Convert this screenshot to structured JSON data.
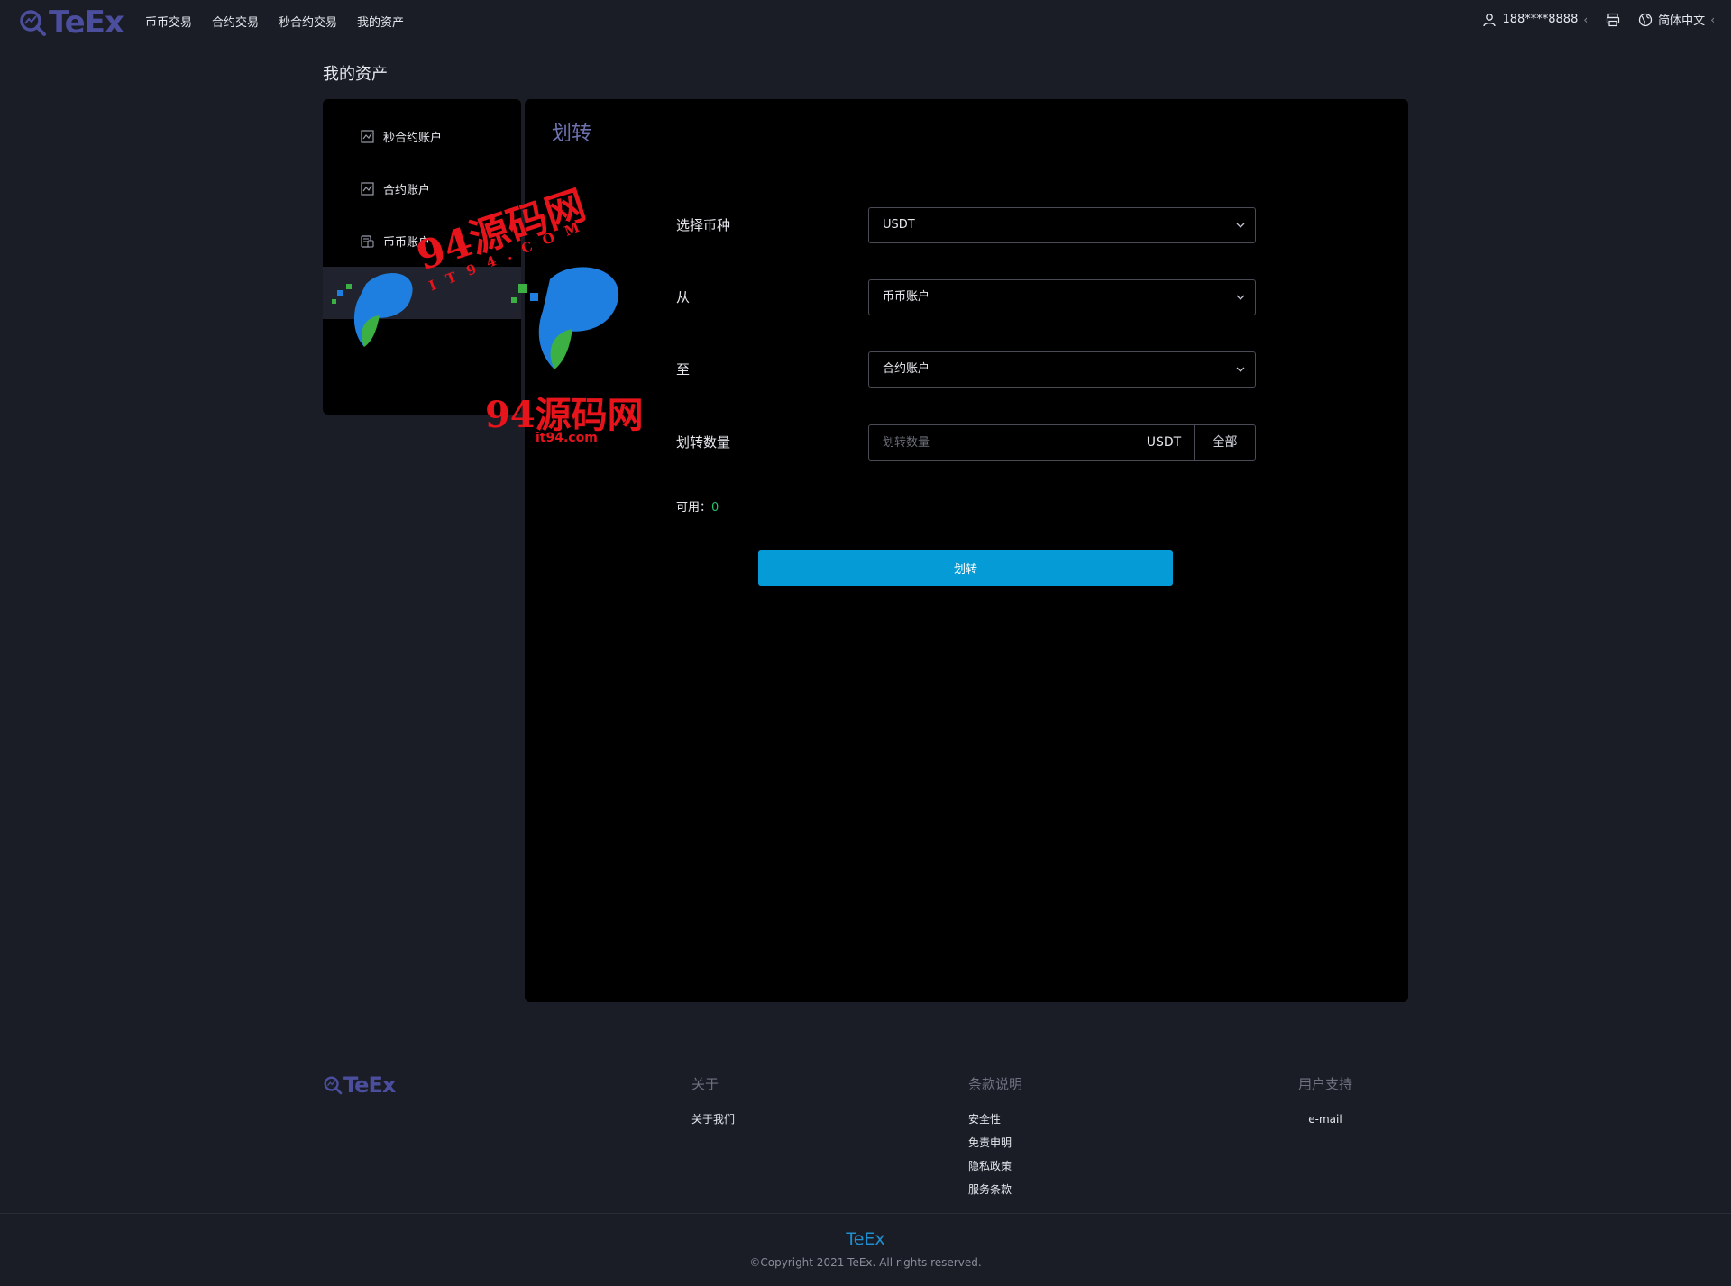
{
  "brand": {
    "logo_text": "TeEx"
  },
  "nav": {
    "items": [
      "币币交易",
      "合约交易",
      "秒合约交易",
      "我的资产"
    ]
  },
  "header_right": {
    "user": "188****8888",
    "language": "简体中文"
  },
  "page_title": "我的资产",
  "sidebar": {
    "items": [
      {
        "label": "秒合约账户",
        "icon": "chart-icon"
      },
      {
        "label": "合约账户",
        "icon": "chart-icon"
      },
      {
        "label": "币币账户",
        "icon": "wallet-icon"
      }
    ]
  },
  "transfer": {
    "title": "划转",
    "coin_label": "选择币种",
    "coin_value": "USDT",
    "from_label": "从",
    "from_value": "币币账户",
    "to_label": "至",
    "to_value": "合约账户",
    "amount_label": "划转数量",
    "amount_placeholder": "划转数量",
    "amount_unit": "USDT",
    "all_label": "全部",
    "available_label": "可用：",
    "available_value": "0",
    "submit_label": "划转"
  },
  "watermark": {
    "text_main": "94源码网",
    "text_spaced": "I T 9 4 . C O M",
    "text_bottom": "94源码网",
    "text_url": "it94.com"
  },
  "footer": {
    "about": {
      "title": "关于",
      "links": [
        "关于我们"
      ]
    },
    "terms": {
      "title": "条款说明",
      "links": [
        "安全性",
        "免责申明",
        "隐私政策",
        "服务条款"
      ]
    },
    "support": {
      "title": "用户支持",
      "links": [
        "e-mail"
      ]
    },
    "brand": "TeEx",
    "copyright": "©Copyright 2021 TeEx. All rights reserved."
  },
  "colors": {
    "background": "#1a1c26",
    "panel": "#000000",
    "accent_button": "#049bd6",
    "logo": "#4a4e9c",
    "available_value": "#27c36a",
    "watermark_red": "#e8141c"
  }
}
